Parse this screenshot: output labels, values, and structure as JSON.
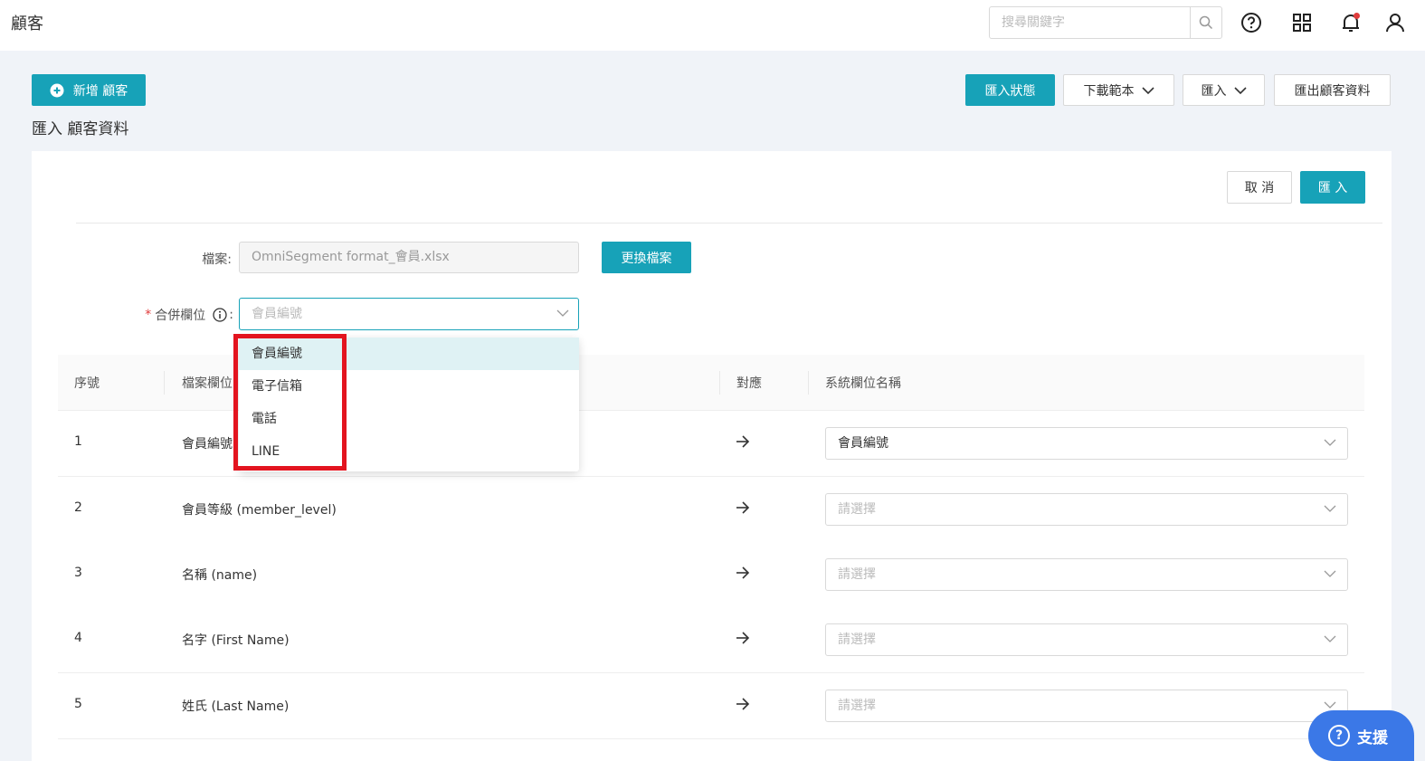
{
  "header": {
    "title": "顧客",
    "search_placeholder": "搜尋關鍵字"
  },
  "actions": {
    "add_customer": "新增 顧客",
    "import_status": "匯入狀態",
    "download_template": "下載範本",
    "import": "匯入",
    "export_customers": "匯出顧客資料"
  },
  "page": {
    "subtitle": "匯入 顧客資料"
  },
  "form": {
    "cancel": "取 消",
    "submit": "匯 入",
    "file_label": "檔案:",
    "file_value": "OmniSegment format_會員.xlsx",
    "change_file": "更換檔案",
    "merge_label": "合併欄位",
    "merge_colon": ":",
    "merge_placeholder": "會員編號"
  },
  "dropdown": {
    "options": [
      "會員編號",
      "電子信箱",
      "電話",
      "LINE"
    ],
    "active_index": 0
  },
  "table": {
    "columns": [
      "序號",
      "檔案欄位",
      "對應",
      "系統欄位名稱"
    ],
    "rows": [
      {
        "index": "1",
        "field": "會員編號",
        "mapping": "會員編號",
        "is_placeholder": false
      },
      {
        "index": "2",
        "field": "會員等級 (member_level)",
        "mapping": "請選擇",
        "is_placeholder": true
      },
      {
        "index": "3",
        "field": "名稱 (name)",
        "mapping": "請選擇",
        "is_placeholder": true
      },
      {
        "index": "4",
        "field": "名字 (First Name)",
        "mapping": "請選擇",
        "is_placeholder": true
      },
      {
        "index": "5",
        "field": "姓氏 (Last Name)",
        "mapping": "請選擇",
        "is_placeholder": true
      }
    ]
  },
  "support": {
    "label": "支援"
  },
  "colors": {
    "primary": "#17a2b8",
    "highlight": "#e3141f",
    "support": "#3b78e7"
  }
}
